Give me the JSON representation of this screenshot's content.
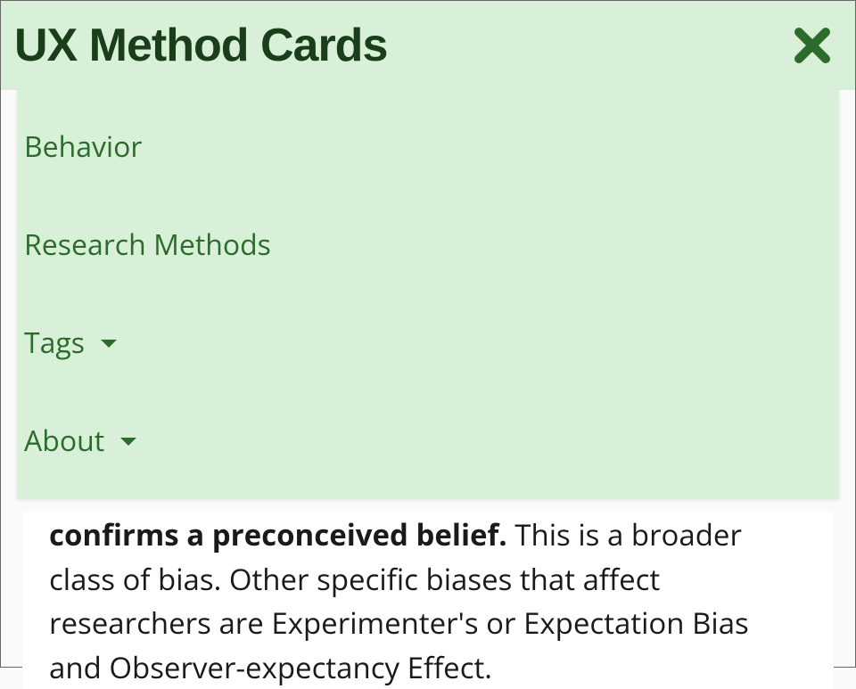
{
  "header": {
    "title": "UX Method Cards"
  },
  "menu": {
    "items": [
      {
        "label": "Behavior",
        "has_dropdown": false
      },
      {
        "label": "Research Methods",
        "has_dropdown": false
      },
      {
        "label": "Tags",
        "has_dropdown": true
      },
      {
        "label": "About",
        "has_dropdown": true
      }
    ]
  },
  "content": {
    "bold_fragment": "confirms a preconceived belief.",
    "rest_fragment": " This is a broader class of bias. Other specific biases that affect researchers are Experimenter's or Expectation Bias and Observer-expectancy Effect."
  },
  "colors": {
    "menu_bg": "#d8f0d8",
    "menu_text": "#2d6b2d",
    "title_text": "#1a3d1a"
  }
}
